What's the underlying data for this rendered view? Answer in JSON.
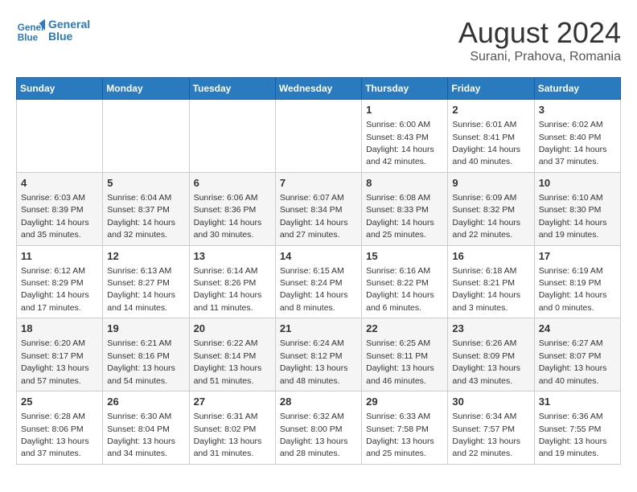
{
  "logo": {
    "line1": "General",
    "line2": "Blue"
  },
  "title": "August 2024",
  "subtitle": "Surani, Prahova, Romania",
  "weekdays": [
    "Sunday",
    "Monday",
    "Tuesday",
    "Wednesday",
    "Thursday",
    "Friday",
    "Saturday"
  ],
  "weeks": [
    [
      {
        "day": "",
        "info": ""
      },
      {
        "day": "",
        "info": ""
      },
      {
        "day": "",
        "info": ""
      },
      {
        "day": "",
        "info": ""
      },
      {
        "day": "1",
        "info": "Sunrise: 6:00 AM\nSunset: 8:43 PM\nDaylight: 14 hours\nand 42 minutes."
      },
      {
        "day": "2",
        "info": "Sunrise: 6:01 AM\nSunset: 8:41 PM\nDaylight: 14 hours\nand 40 minutes."
      },
      {
        "day": "3",
        "info": "Sunrise: 6:02 AM\nSunset: 8:40 PM\nDaylight: 14 hours\nand 37 minutes."
      }
    ],
    [
      {
        "day": "4",
        "info": "Sunrise: 6:03 AM\nSunset: 8:39 PM\nDaylight: 14 hours\nand 35 minutes."
      },
      {
        "day": "5",
        "info": "Sunrise: 6:04 AM\nSunset: 8:37 PM\nDaylight: 14 hours\nand 32 minutes."
      },
      {
        "day": "6",
        "info": "Sunrise: 6:06 AM\nSunset: 8:36 PM\nDaylight: 14 hours\nand 30 minutes."
      },
      {
        "day": "7",
        "info": "Sunrise: 6:07 AM\nSunset: 8:34 PM\nDaylight: 14 hours\nand 27 minutes."
      },
      {
        "day": "8",
        "info": "Sunrise: 6:08 AM\nSunset: 8:33 PM\nDaylight: 14 hours\nand 25 minutes."
      },
      {
        "day": "9",
        "info": "Sunrise: 6:09 AM\nSunset: 8:32 PM\nDaylight: 14 hours\nand 22 minutes."
      },
      {
        "day": "10",
        "info": "Sunrise: 6:10 AM\nSunset: 8:30 PM\nDaylight: 14 hours\nand 19 minutes."
      }
    ],
    [
      {
        "day": "11",
        "info": "Sunrise: 6:12 AM\nSunset: 8:29 PM\nDaylight: 14 hours\nand 17 minutes."
      },
      {
        "day": "12",
        "info": "Sunrise: 6:13 AM\nSunset: 8:27 PM\nDaylight: 14 hours\nand 14 minutes."
      },
      {
        "day": "13",
        "info": "Sunrise: 6:14 AM\nSunset: 8:26 PM\nDaylight: 14 hours\nand 11 minutes."
      },
      {
        "day": "14",
        "info": "Sunrise: 6:15 AM\nSunset: 8:24 PM\nDaylight: 14 hours\nand 8 minutes."
      },
      {
        "day": "15",
        "info": "Sunrise: 6:16 AM\nSunset: 8:22 PM\nDaylight: 14 hours\nand 6 minutes."
      },
      {
        "day": "16",
        "info": "Sunrise: 6:18 AM\nSunset: 8:21 PM\nDaylight: 14 hours\nand 3 minutes."
      },
      {
        "day": "17",
        "info": "Sunrise: 6:19 AM\nSunset: 8:19 PM\nDaylight: 14 hours\nand 0 minutes."
      }
    ],
    [
      {
        "day": "18",
        "info": "Sunrise: 6:20 AM\nSunset: 8:17 PM\nDaylight: 13 hours\nand 57 minutes."
      },
      {
        "day": "19",
        "info": "Sunrise: 6:21 AM\nSunset: 8:16 PM\nDaylight: 13 hours\nand 54 minutes."
      },
      {
        "day": "20",
        "info": "Sunrise: 6:22 AM\nSunset: 8:14 PM\nDaylight: 13 hours\nand 51 minutes."
      },
      {
        "day": "21",
        "info": "Sunrise: 6:24 AM\nSunset: 8:12 PM\nDaylight: 13 hours\nand 48 minutes."
      },
      {
        "day": "22",
        "info": "Sunrise: 6:25 AM\nSunset: 8:11 PM\nDaylight: 13 hours\nand 46 minutes."
      },
      {
        "day": "23",
        "info": "Sunrise: 6:26 AM\nSunset: 8:09 PM\nDaylight: 13 hours\nand 43 minutes."
      },
      {
        "day": "24",
        "info": "Sunrise: 6:27 AM\nSunset: 8:07 PM\nDaylight: 13 hours\nand 40 minutes."
      }
    ],
    [
      {
        "day": "25",
        "info": "Sunrise: 6:28 AM\nSunset: 8:06 PM\nDaylight: 13 hours\nand 37 minutes."
      },
      {
        "day": "26",
        "info": "Sunrise: 6:30 AM\nSunset: 8:04 PM\nDaylight: 13 hours\nand 34 minutes."
      },
      {
        "day": "27",
        "info": "Sunrise: 6:31 AM\nSunset: 8:02 PM\nDaylight: 13 hours\nand 31 minutes."
      },
      {
        "day": "28",
        "info": "Sunrise: 6:32 AM\nSunset: 8:00 PM\nDaylight: 13 hours\nand 28 minutes."
      },
      {
        "day": "29",
        "info": "Sunrise: 6:33 AM\nSunset: 7:58 PM\nDaylight: 13 hours\nand 25 minutes."
      },
      {
        "day": "30",
        "info": "Sunrise: 6:34 AM\nSunset: 7:57 PM\nDaylight: 13 hours\nand 22 minutes."
      },
      {
        "day": "31",
        "info": "Sunrise: 6:36 AM\nSunset: 7:55 PM\nDaylight: 13 hours\nand 19 minutes."
      }
    ]
  ]
}
